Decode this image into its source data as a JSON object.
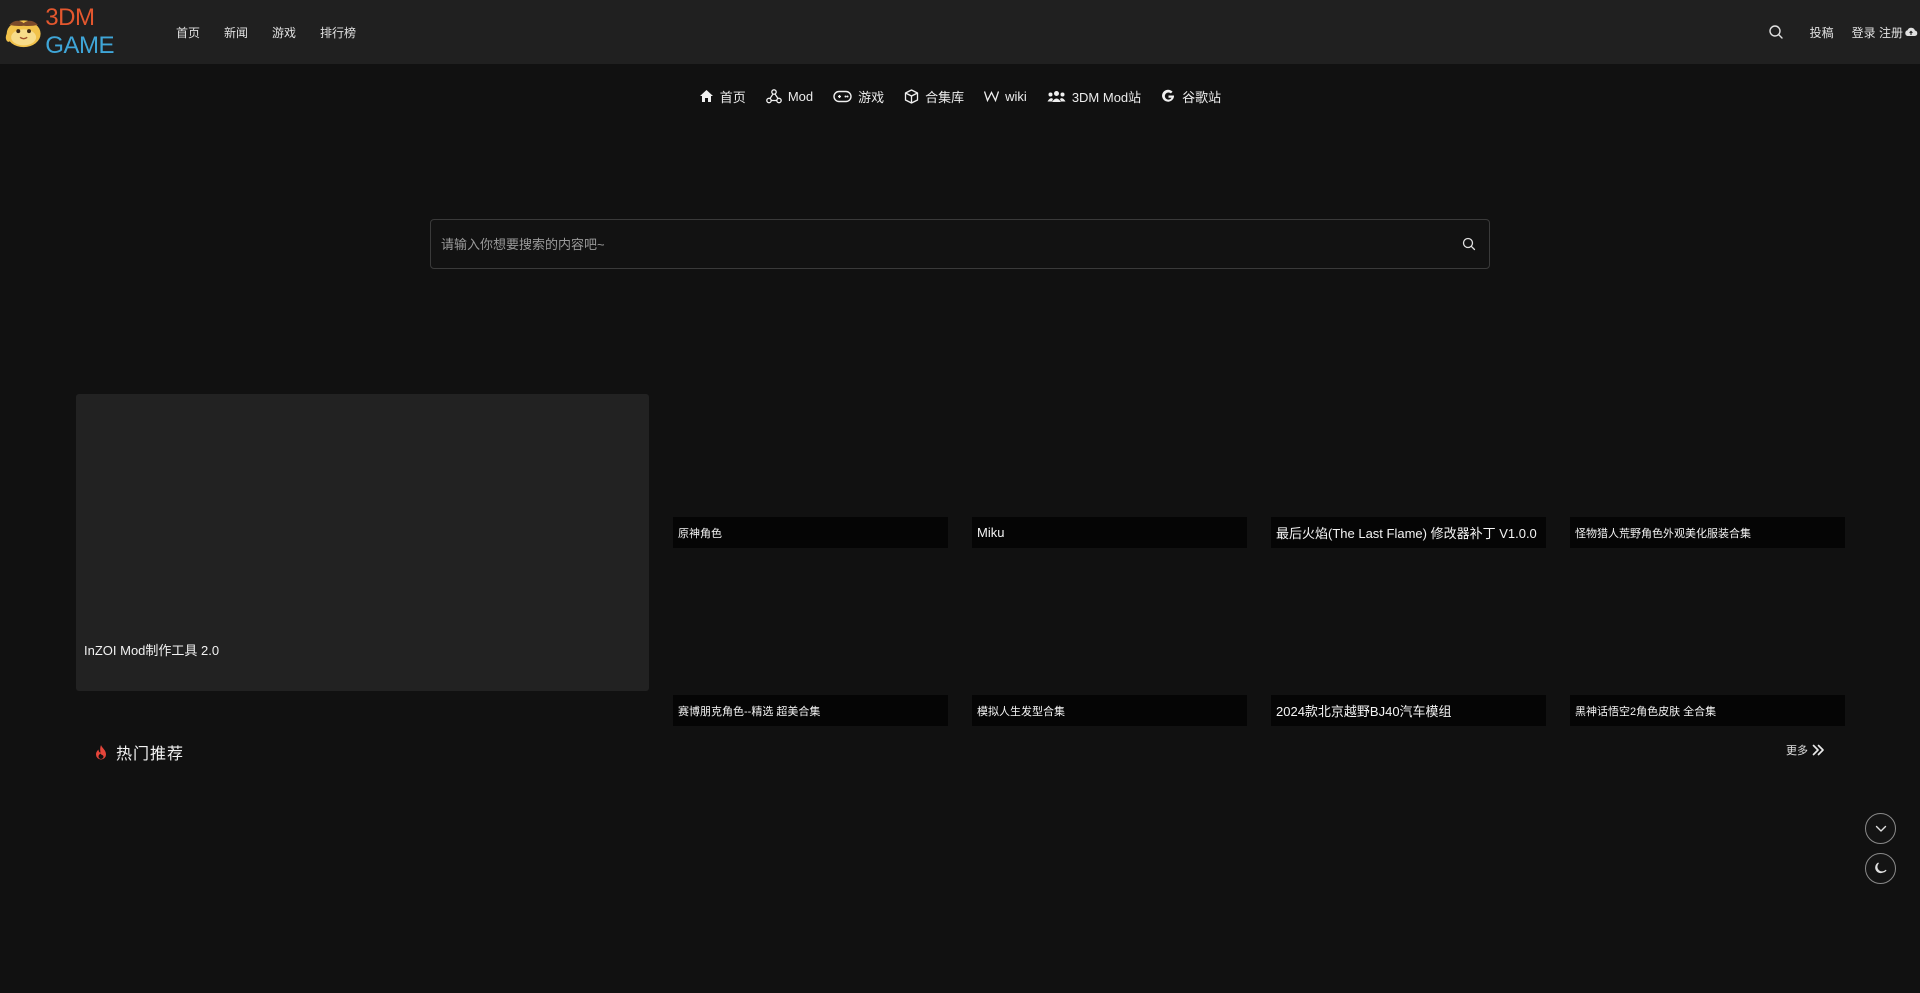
{
  "header": {
    "logo_text_a": "3DM",
    "logo_text_b": "GAME",
    "nav": [
      "首页",
      "新闻",
      "游戏",
      "排行榜"
    ],
    "right_links": [
      "投稿"
    ],
    "user_label": "登录 注册"
  },
  "subnav": [
    {
      "label": "首页",
      "icon": "home-icon"
    },
    {
      "label": "Mod",
      "icon": "nodes-icon"
    },
    {
      "label": "游戏",
      "icon": "gamepad-icon"
    },
    {
      "label": "合集库",
      "icon": "cube-icon"
    },
    {
      "label": "wiki",
      "icon": "wiki-icon"
    },
    {
      "label": "3DM Mod站",
      "icon": "users-icon"
    },
    {
      "label": "谷歌站",
      "icon": "google-icon"
    }
  ],
  "search": {
    "placeholder": "请输入你想要搜索的内容吧~"
  },
  "featured": {
    "main_caption": "InZOI Mod制作工具 2.0",
    "tiles": [
      "原神角色",
      "Miku",
      "最后火焰(The Last Flame) 修改器补丁 V1.0.0",
      "怪物猎人荒野角色外观美化服装合集",
      "赛博朋克角色--精选 超美合集",
      "模拟人生发型合集",
      "2024款北京越野BJ40汽车模组",
      "黑神话悟空2角色皮肤 全合集"
    ]
  },
  "hot": {
    "title": "热门推荐",
    "more_label": "更多"
  },
  "colors": {
    "page_bg": "#111111",
    "header_bg": "#202020",
    "card_bg": "#222222",
    "caption_bg": "#050505",
    "fire": "#e5453a",
    "logo_orange": "#e4572e",
    "logo_blue": "#3fa6d8"
  }
}
